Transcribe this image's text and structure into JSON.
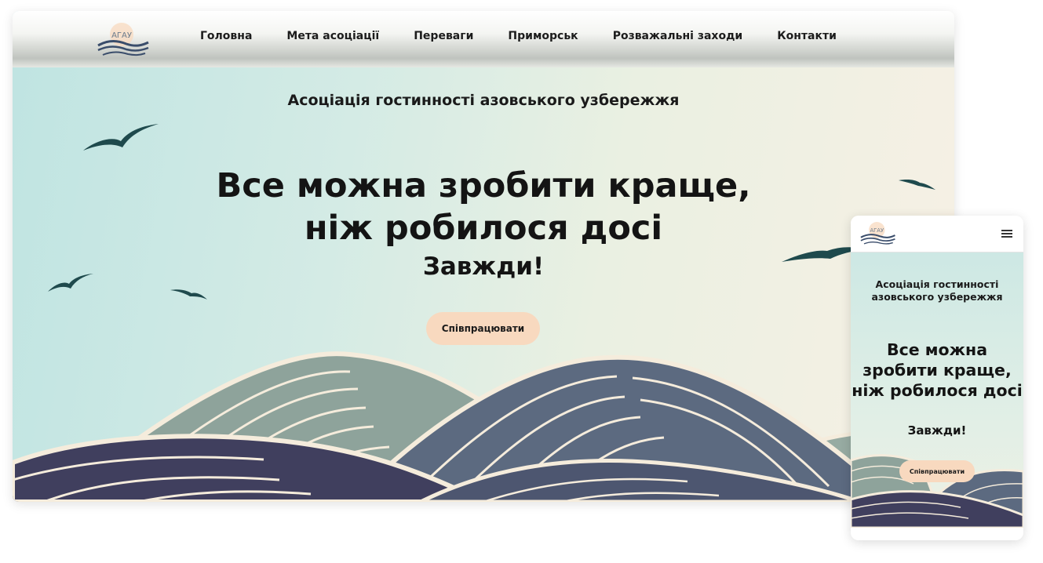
{
  "brand": {
    "logo_text": "АГАУ"
  },
  "nav": {
    "items": [
      "Головна",
      "Мета асоціації",
      "Переваги",
      "Приморськ",
      "Розважальні заходи",
      "Контакти"
    ]
  },
  "hero": {
    "subtitle": "Асоціація гостинності азовського узбережжя",
    "headline_line1": "Все можна зробити краще,",
    "headline_line2": "ніж робилося досі",
    "tagline": "Завжди!",
    "cta_label": "Співпрацювати"
  },
  "mobile": {
    "subtitle": "Асоціація гостинності азовського узбережжя",
    "headline": "Все можна зробити краще, ніж робилося досі",
    "tagline": "Завжди!",
    "cta_label": "Співпрацювати"
  },
  "colors": {
    "button": "#f8d9bf",
    "bird": "#1f4a4d",
    "wave_light": "#8ea39b",
    "wave_mid": "#5c6a80",
    "wave_dark": "#403f5e",
    "wave_line": "#f5ecdc"
  },
  "icons": {
    "menu": "hamburger-icon",
    "logo": "waves-logo"
  }
}
